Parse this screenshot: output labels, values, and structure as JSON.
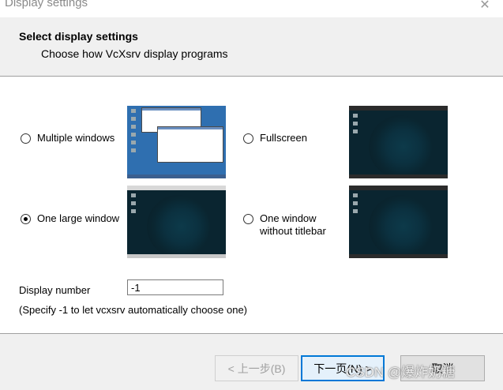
{
  "window": {
    "title": "Display settings",
    "close_symbol": "✕"
  },
  "header": {
    "title": "Select display settings",
    "subtitle": "Choose how VcXsrv display programs"
  },
  "options": [
    {
      "label": "Multiple windows",
      "selected": false,
      "preview": "desktop-with-windows"
    },
    {
      "label": "Fullscreen",
      "selected": false,
      "preview": "dark-desktop"
    },
    {
      "label": "One large window",
      "selected": true,
      "preview": "dark-desktop"
    },
    {
      "label_line1": "One window",
      "label_line2": "without titlebar",
      "selected": false,
      "preview": "dark-desktop"
    }
  ],
  "display_number": {
    "label": "Display number",
    "value": "-1",
    "hint": "(Specify -1 to let vcxsrv automatically choose one)"
  },
  "buttons": {
    "back": "< 上一步(B)",
    "next": "下一页(N) >",
    "cancel": "取消"
  },
  "watermark": "CSDN @爆炸奶糖",
  "colors": {
    "accent": "#0078d7",
    "preview_blue": "#2f6fb0",
    "preview_dark": "#0a2530"
  }
}
